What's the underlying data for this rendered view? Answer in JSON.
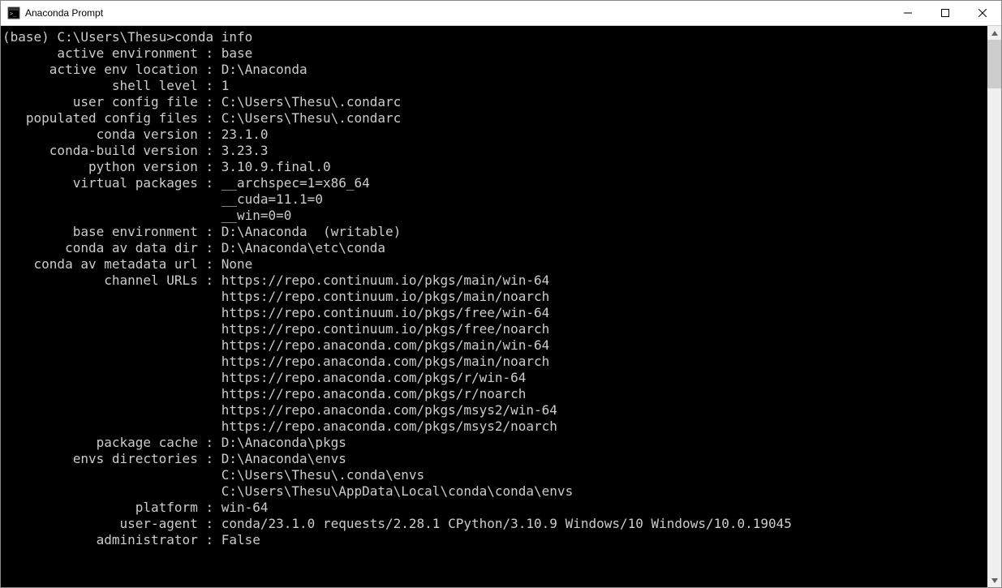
{
  "window": {
    "title": "Anaconda Prompt"
  },
  "prompt": {
    "prefix": "(base) C:\\Users\\Thesu>",
    "command": "conda info"
  },
  "info": {
    "rows": [
      {
        "label": "active environment",
        "value": "base"
      },
      {
        "label": "active env location",
        "value": "D:\\Anaconda"
      },
      {
        "label": "shell level",
        "value": "1"
      },
      {
        "label": "user config file",
        "value": "C:\\Users\\Thesu\\.condarc"
      },
      {
        "label": "populated config files",
        "value": "C:\\Users\\Thesu\\.condarc"
      },
      {
        "label": "conda version",
        "value": "23.1.0"
      },
      {
        "label": "conda-build version",
        "value": "3.23.3"
      },
      {
        "label": "python version",
        "value": "3.10.9.final.0"
      },
      {
        "label": "virtual packages",
        "value": "__archspec=1=x86_64"
      },
      {
        "label": "",
        "value": "__cuda=11.1=0"
      },
      {
        "label": "",
        "value": "__win=0=0"
      },
      {
        "label": "base environment",
        "value": "D:\\Anaconda  (writable)"
      },
      {
        "label": "conda av data dir",
        "value": "D:\\Anaconda\\etc\\conda"
      },
      {
        "label": "conda av metadata url",
        "value": "None"
      },
      {
        "label": "channel URLs",
        "value": "https://repo.continuum.io/pkgs/main/win-64"
      },
      {
        "label": "",
        "value": "https://repo.continuum.io/pkgs/main/noarch"
      },
      {
        "label": "",
        "value": "https://repo.continuum.io/pkgs/free/win-64"
      },
      {
        "label": "",
        "value": "https://repo.continuum.io/pkgs/free/noarch"
      },
      {
        "label": "",
        "value": "https://repo.anaconda.com/pkgs/main/win-64"
      },
      {
        "label": "",
        "value": "https://repo.anaconda.com/pkgs/main/noarch"
      },
      {
        "label": "",
        "value": "https://repo.anaconda.com/pkgs/r/win-64"
      },
      {
        "label": "",
        "value": "https://repo.anaconda.com/pkgs/r/noarch"
      },
      {
        "label": "",
        "value": "https://repo.anaconda.com/pkgs/msys2/win-64"
      },
      {
        "label": "",
        "value": "https://repo.anaconda.com/pkgs/msys2/noarch"
      },
      {
        "label": "package cache",
        "value": "D:\\Anaconda\\pkgs"
      },
      {
        "label": "envs directories",
        "value": "D:\\Anaconda\\envs"
      },
      {
        "label": "",
        "value": "C:\\Users\\Thesu\\.conda\\envs"
      },
      {
        "label": "",
        "value": "C:\\Users\\Thesu\\AppData\\Local\\conda\\conda\\envs"
      },
      {
        "label": "platform",
        "value": "win-64"
      },
      {
        "label": "user-agent",
        "value": "conda/23.1.0 requests/2.28.1 CPython/3.10.9 Windows/10 Windows/10.0.19045"
      },
      {
        "label": "administrator",
        "value": "False"
      }
    ],
    "label_width": 25
  }
}
